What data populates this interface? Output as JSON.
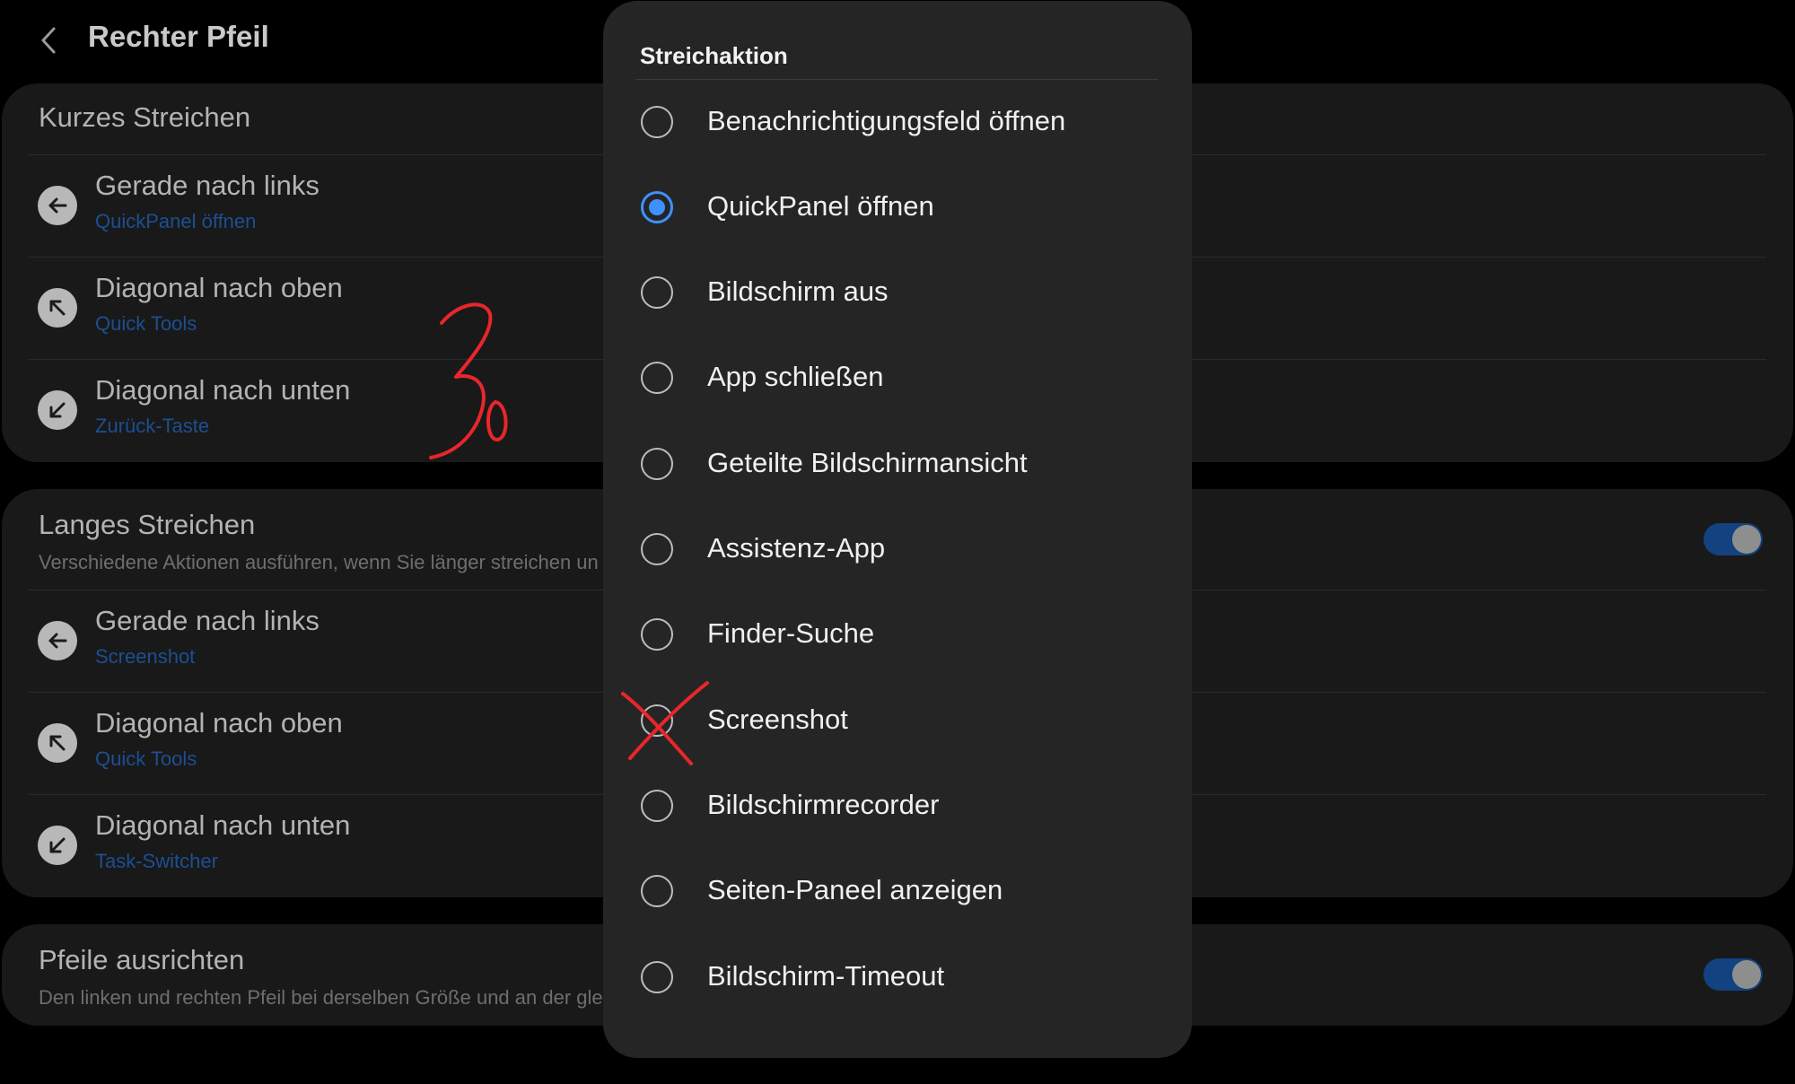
{
  "header": {
    "title": "Rechter Pfeil",
    "back_icon": "chevron-left-icon"
  },
  "short_swipe": {
    "title": "Kurzes Streichen",
    "rows": [
      {
        "label": "Gerade nach links",
        "value": "QuickPanel öffnen",
        "icon": "arrow-left-icon"
      },
      {
        "label": "Diagonal nach oben",
        "value": "Quick Tools",
        "icon": "arrow-up-left-icon"
      },
      {
        "label": "Diagonal nach unten",
        "value": "Zurück-Taste",
        "icon": "arrow-down-left-icon"
      }
    ]
  },
  "long_swipe": {
    "title": "Langes Streichen",
    "subtitle": "Verschiedene Aktionen ausführen, wenn Sie länger streichen un",
    "toggle_on": true,
    "rows": [
      {
        "label": "Gerade nach links",
        "value": "Screenshot",
        "icon": "arrow-left-icon"
      },
      {
        "label": "Diagonal nach oben",
        "value": "Quick Tools",
        "icon": "arrow-up-left-icon"
      },
      {
        "label": "Diagonal nach unten",
        "value": "Task-Switcher",
        "icon": "arrow-down-left-icon"
      }
    ]
  },
  "align_arrows": {
    "title": "Pfeile ausrichten",
    "subtitle": "Den linken und rechten Pfeil bei derselben Größe und an der gle",
    "toggle_on": true
  },
  "dialog": {
    "title": "Streichaktion",
    "selected_index": 1,
    "options": [
      "Benachrichtigungsfeld öffnen",
      "QuickPanel öffnen",
      "Bildschirm aus",
      "App schließen",
      "Geteilte Bildschirmansicht",
      "Assistenz-App",
      "Finder-Suche",
      "Screenshot",
      "Bildschirmrecorder",
      "Seiten-Paneel anzeigen",
      "Bildschirm-Timeout"
    ]
  },
  "colors": {
    "accent": "#3e91ff",
    "value_text_dimmed": "#1c4f92",
    "annotation_red": "#e8262b"
  }
}
